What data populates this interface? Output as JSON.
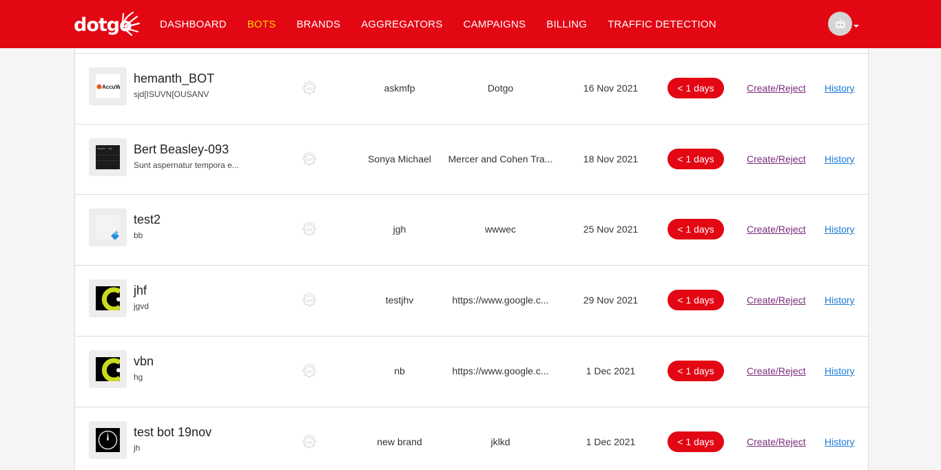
{
  "header": {
    "logo_text": "dotgo",
    "nav": [
      {
        "label": "DASHBOARD",
        "active": false
      },
      {
        "label": "BOTS",
        "active": true
      },
      {
        "label": "BRANDS",
        "active": false
      },
      {
        "label": "AGGREGATORS",
        "active": false
      },
      {
        "label": "CAMPAIGNS",
        "active": false
      },
      {
        "label": "BILLING",
        "active": false
      },
      {
        "label": "TRAFFIC DETECTION",
        "active": false
      }
    ],
    "colors": {
      "bar": "#e30613",
      "active": "#ffd400"
    }
  },
  "rows": [
    {
      "name": "hemanth_BOT",
      "desc": "sjd[ISUVN[OUSANV",
      "thumb": "accuweather-logo",
      "brand": "askmfp",
      "aggregator": "Dotgo",
      "date": "16 Nov 2021",
      "badge": "< 1 days",
      "action": "Create/Reject",
      "history": "History"
    },
    {
      "name": "Bert Beasley-093",
      "desc": "Sunt aspernatur tempora e...",
      "thumb": "dark-screenshot",
      "brand": "Sonya Michael",
      "aggregator": "Mercer and Cohen Tra...",
      "date": "18 Nov 2021",
      "badge": "< 1 days",
      "action": "Create/Reject",
      "history": "History"
    },
    {
      "name": "test2",
      "desc": "bb",
      "thumb": "blue-shape",
      "brand": "jgh",
      "aggregator": "wwwec",
      "date": "25 Nov 2021",
      "badge": "< 1 days",
      "action": "Create/Reject",
      "history": "History"
    },
    {
      "name": "jhf",
      "desc": "jgvd",
      "thumb": "black-yellow-logo",
      "brand": "testjhv",
      "aggregator": "https://www.google.c...",
      "date": "29 Nov 2021",
      "badge": "< 1 days",
      "action": "Create/Reject",
      "history": "History"
    },
    {
      "name": "vbn",
      "desc": "hg",
      "thumb": "black-yellow-logo",
      "brand": "nb",
      "aggregator": "https://www.google.c...",
      "date": "1 Dec 2021",
      "badge": "< 1 days",
      "action": "Create/Reject",
      "history": "History"
    },
    {
      "name": "test bot 19nov",
      "desc": "jh",
      "thumb": "mercedes-logo",
      "brand": "new brand",
      "aggregator": "jklkd",
      "date": "1 Dec 2021",
      "badge": "< 1 days",
      "action": "Create/Reject",
      "history": "History"
    }
  ]
}
